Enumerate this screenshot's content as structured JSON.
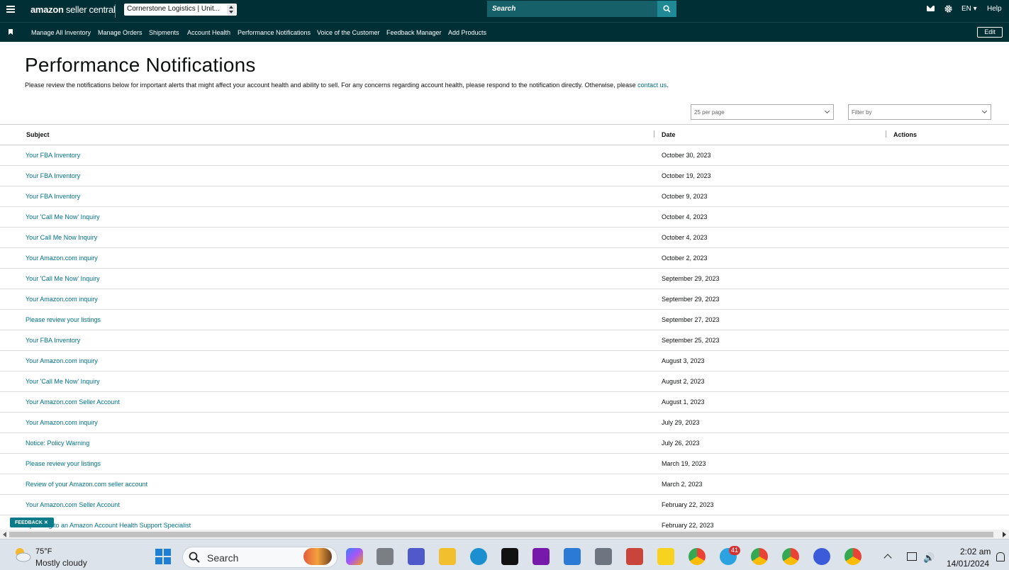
{
  "topbar": {
    "brand_amazon": "amazon",
    "brand_rest": " seller central",
    "account_selector": "Cornerstone Logistics | Unit...",
    "search_placeholder": "Search",
    "language": "EN",
    "help": "Help"
  },
  "nav": {
    "items": [
      "Manage All Inventory",
      "Manage Orders",
      "Shipments",
      "Account Health",
      "Performance Notifications",
      "Voice of the Customer",
      "Feedback Manager",
      "Add Products"
    ],
    "edit": "Edit"
  },
  "page": {
    "title": "Performance Notifications",
    "intro": "Please review the notifications below for important alerts that might affect your account health and ability to sell. For any concerns regarding account health, please respond to the notification directly. Otherwise, please ",
    "contact_link": "contact us",
    "intro_end": ".",
    "per_page": "25 per page",
    "filter": "Filter by"
  },
  "table": {
    "headers": {
      "subject": "Subject",
      "date": "Date",
      "actions": "Actions"
    },
    "rows": [
      {
        "subject": "Your FBA Inventory",
        "date": "October 30, 2023"
      },
      {
        "subject": "Your FBA Inventory",
        "date": "October 19, 2023"
      },
      {
        "subject": "Your FBA Inventory",
        "date": "October 9, 2023"
      },
      {
        "subject": "Your 'Call Me Now' Inquiry",
        "date": "October 4, 2023"
      },
      {
        "subject": "Your Call Me Now Inquiry",
        "date": "October 4, 2023"
      },
      {
        "subject": "Your Amazon.com inquiry",
        "date": "October 2, 2023"
      },
      {
        "subject": "Your 'Call Me Now' Inquiry",
        "date": "September 29, 2023"
      },
      {
        "subject": "Your Amazon.com inquiry",
        "date": "September 29, 2023"
      },
      {
        "subject": "Please review your listings",
        "date": "September 27, 2023"
      },
      {
        "subject": "Your FBA Inventory",
        "date": "September 25, 2023"
      },
      {
        "subject": "Your Amazon.com inquiry",
        "date": "August 3, 2023"
      },
      {
        "subject": "Your 'Call Me Now' Inquiry",
        "date": "August 2, 2023"
      },
      {
        "subject": "Your Amazon.com Seller Account",
        "date": "August 1, 2023"
      },
      {
        "subject": "Your Amazon.com inquiry",
        "date": "July 29, 2023"
      },
      {
        "subject": "Notice: Policy Warning",
        "date": "July 26, 2023"
      },
      {
        "subject": "Please review your listings",
        "date": "March 19, 2023"
      },
      {
        "subject": "Review of your Amazon.com seller account",
        "date": "March 2, 2023"
      },
      {
        "subject": "Your Amazon.com Seller Account",
        "date": "February 22, 2023"
      },
      {
        "subject": "Speaking to an Amazon Account Health Support Specialist",
        "date": "February 22, 2023"
      }
    ]
  },
  "feedback_tab": "FEEDBACK ✕",
  "taskbar": {
    "temperature": "75°F",
    "condition": "Mostly cloudy",
    "search": "Search",
    "telegram_badge": "41",
    "time": "2:02 am",
    "date": "14/01/2024"
  },
  "colors": {
    "header_bg": "#002f36",
    "search_bg": "#16606a",
    "link": "#007185"
  }
}
